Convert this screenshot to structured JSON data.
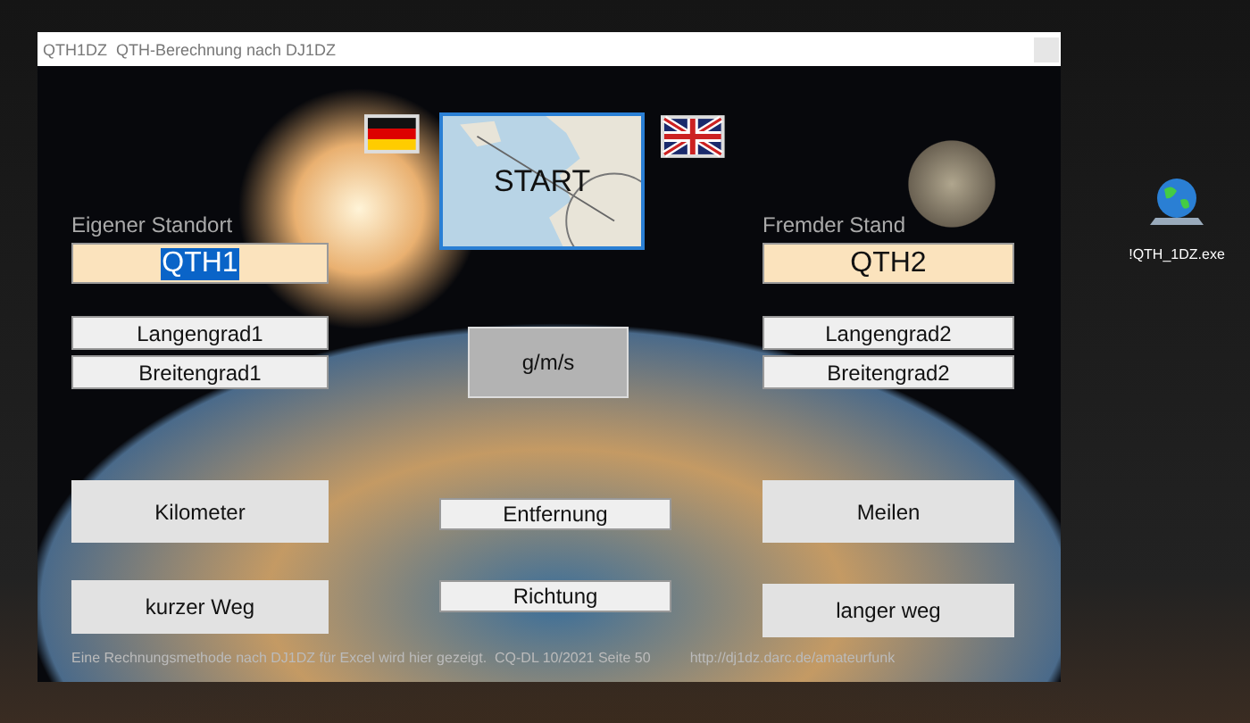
{
  "window": {
    "title": "QTH1DZ  QTH-Berechnung nach DJ1DZ"
  },
  "start_button": {
    "label": "START"
  },
  "left": {
    "heading": "Eigener Standort",
    "qth": {
      "value": "QTH1",
      "highlighted": true
    },
    "longitude": "Langengrad1",
    "latitude": "Breitengrad1",
    "distance_button": "Kilometer",
    "path_button": "kurzer Weg"
  },
  "center": {
    "units_button": "g/m/s",
    "distance_label": "Entfernung",
    "direction_label": "Richtung"
  },
  "right": {
    "heading": "Fremder Stand",
    "qth": {
      "value": "QTH2",
      "highlighted": false
    },
    "longitude": "Langengrad2",
    "latitude": "Breitengrad2",
    "distance_button": "Meilen",
    "path_button": "langer weg"
  },
  "footer": {
    "note": "Eine Rechnungsmethode nach DJ1DZ für Excel wird hier gezeigt.  CQ-DL 10/2021 Seite 50",
    "link": "http://dj1dz.darc.de/amateurfunk"
  },
  "desktop_icon": {
    "label": "!QTH_1DZ.exe"
  }
}
